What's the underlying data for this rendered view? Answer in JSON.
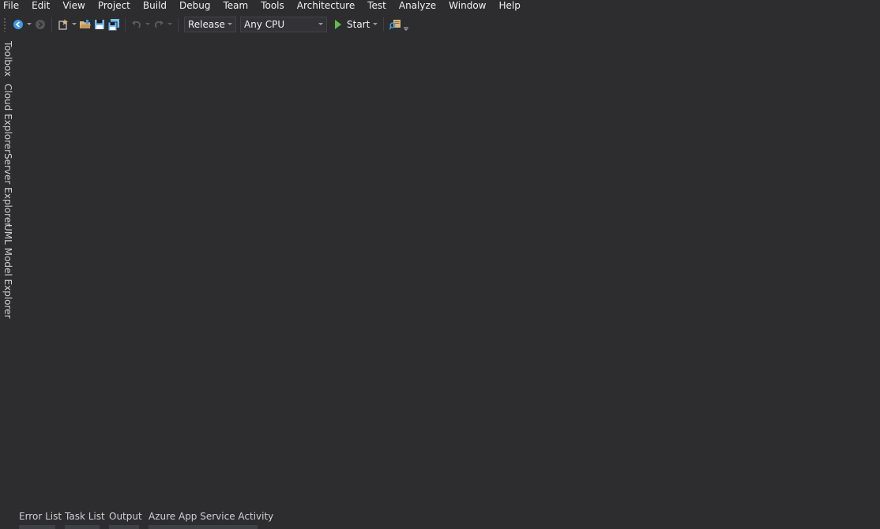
{
  "menu": [
    "File",
    "Edit",
    "View",
    "Project",
    "Build",
    "Debug",
    "Team",
    "Tools",
    "Architecture",
    "Test",
    "Analyze",
    "Window",
    "Help"
  ],
  "toolbar": {
    "configuration": "Release",
    "platform": "Any CPU",
    "start_label": "Start"
  },
  "left_tool_windows": [
    "Toolbox",
    "Cloud Explorer",
    "Server Explorer",
    "UML Model Explorer"
  ],
  "bottom_tool_windows": [
    "Error List",
    "Task List",
    "Output",
    "Azure App Service Activity"
  ],
  "colors": {
    "background": "#2d2d30",
    "text": "#f1f1f1",
    "nav_blue": "#3c9be8",
    "folder_yellow": "#dcb67a",
    "save_blue": "#75beff",
    "start_green": "#5fbe4b"
  },
  "icons": [
    "back-icon",
    "forward-icon",
    "new-project-icon",
    "open-folder-icon",
    "save-icon",
    "save-all-icon",
    "undo-icon",
    "redo-icon",
    "start-icon",
    "find-in-files-icon",
    "toolbar-options-icon"
  ]
}
